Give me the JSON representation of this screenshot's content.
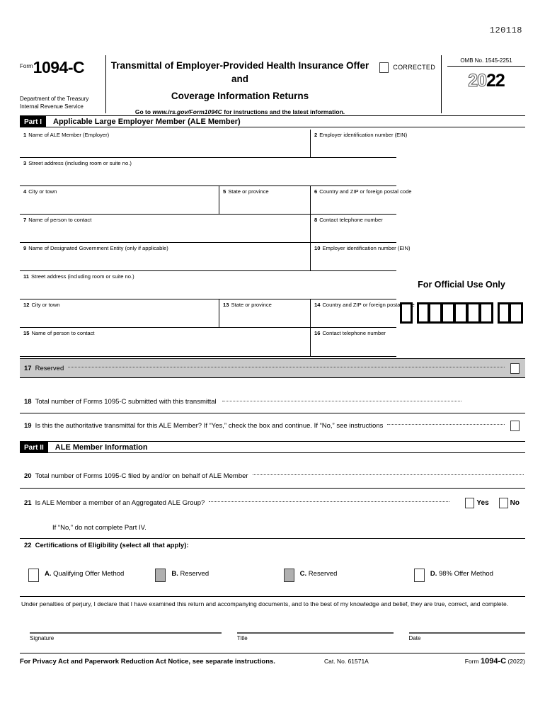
{
  "form": {
    "id_number": "120118",
    "form_word": "Form",
    "form_number": "1094-C",
    "department_line1": "Department of the Treasury",
    "department_line2": "Internal Revenue Service",
    "title_line1": "Transmittal of Employer-Provided Health Insurance Offer and",
    "title_line2": "Coverage Information Returns",
    "goto_prefix": "Go to",
    "goto_url": "www.irs.gov/Form1094C",
    "goto_suffix": "for instructions and the latest information.",
    "corrected_label": "CORRECTED",
    "omb": "OMB No. 1545-2251",
    "year_outline": "20",
    "year_bold": "22"
  },
  "part1": {
    "tag": "Part I",
    "title": "Applicable Large Employer Member (ALE Member)",
    "fields": [
      {
        "num": "1",
        "label": "Name of ALE Member (Employer)"
      },
      {
        "num": "2",
        "label": "Employer identification number (EIN)"
      },
      {
        "num": "3",
        "label": "Street address (including room or suite no.)"
      },
      {
        "num": "4",
        "label": "City or town"
      },
      {
        "num": "5",
        "label": "State or province"
      },
      {
        "num": "6",
        "label": "Country and ZIP or foreign postal code"
      },
      {
        "num": "7",
        "label": "Name of person to contact"
      },
      {
        "num": "8",
        "label": "Contact telephone number"
      },
      {
        "num": "9",
        "label": "Name of Designated Government Entity (only if applicable)"
      },
      {
        "num": "10",
        "label": "Employer identification number (EIN)"
      },
      {
        "num": "11",
        "label": "Street address (including room or suite no.)"
      },
      {
        "num": "12",
        "label": "City or town"
      },
      {
        "num": "13",
        "label": "State or province"
      },
      {
        "num": "14",
        "label": "Country and ZIP or foreign postal code"
      },
      {
        "num": "15",
        "label": "Name of person to contact"
      },
      {
        "num": "16",
        "label": "Contact telephone number"
      }
    ]
  },
  "official_use": {
    "title": "For Official Use Only",
    "group1_boxes": 1,
    "group2_boxes": 6,
    "group3_boxes": 2
  },
  "line17": {
    "num": "17",
    "text": "Reserved",
    "shaded": true
  },
  "line18": {
    "num": "18",
    "text": "Total number of Forms 1095-C submitted with this transmittal"
  },
  "line19": {
    "num": "19",
    "text": "Is this the authoritative transmittal for this ALE Member? If “Yes,” check the box and continue. If “No,” see instructions"
  },
  "part2": {
    "tag": "Part II",
    "title": "ALE Member Information"
  },
  "line20": {
    "num": "20",
    "text": "Total number of Forms 1095-C filed by and/or on behalf of ALE Member"
  },
  "line21": {
    "num": "21",
    "text": "Is ALE Member a member of an Aggregated ALE Group?",
    "yes_label": "Yes",
    "no_label": "No",
    "note": "If “No,” do not complete Part IV."
  },
  "line22": {
    "num": "22",
    "text": "Certifications of Eligibility (select all that apply):",
    "certifications": [
      {
        "letter": "A.",
        "label": "Qualifying Offer Method",
        "shaded": false
      },
      {
        "letter": "B.",
        "label": "Reserved",
        "shaded": true
      },
      {
        "letter": "C.",
        "label": "Reserved",
        "shaded": true
      },
      {
        "letter": "D.",
        "label": "98% Offer Method",
        "shaded": false
      }
    ]
  },
  "perjury": {
    "text": "Under penalties of perjury, I declare that I have examined this return and accompanying documents, and to the best of my knowledge and belief, they are true, correct, and complete."
  },
  "signature_block": {
    "signature_label": "Signature",
    "title_label": "Title",
    "date_label": "Date"
  },
  "footer": {
    "privacy_notice": "For Privacy Act and Paperwork Reduction Act Notice, see separate instructions.",
    "cat_no": "Cat. No. 61571A",
    "form_word": "Form",
    "form_number": "1094-C",
    "year": "(2022)"
  }
}
